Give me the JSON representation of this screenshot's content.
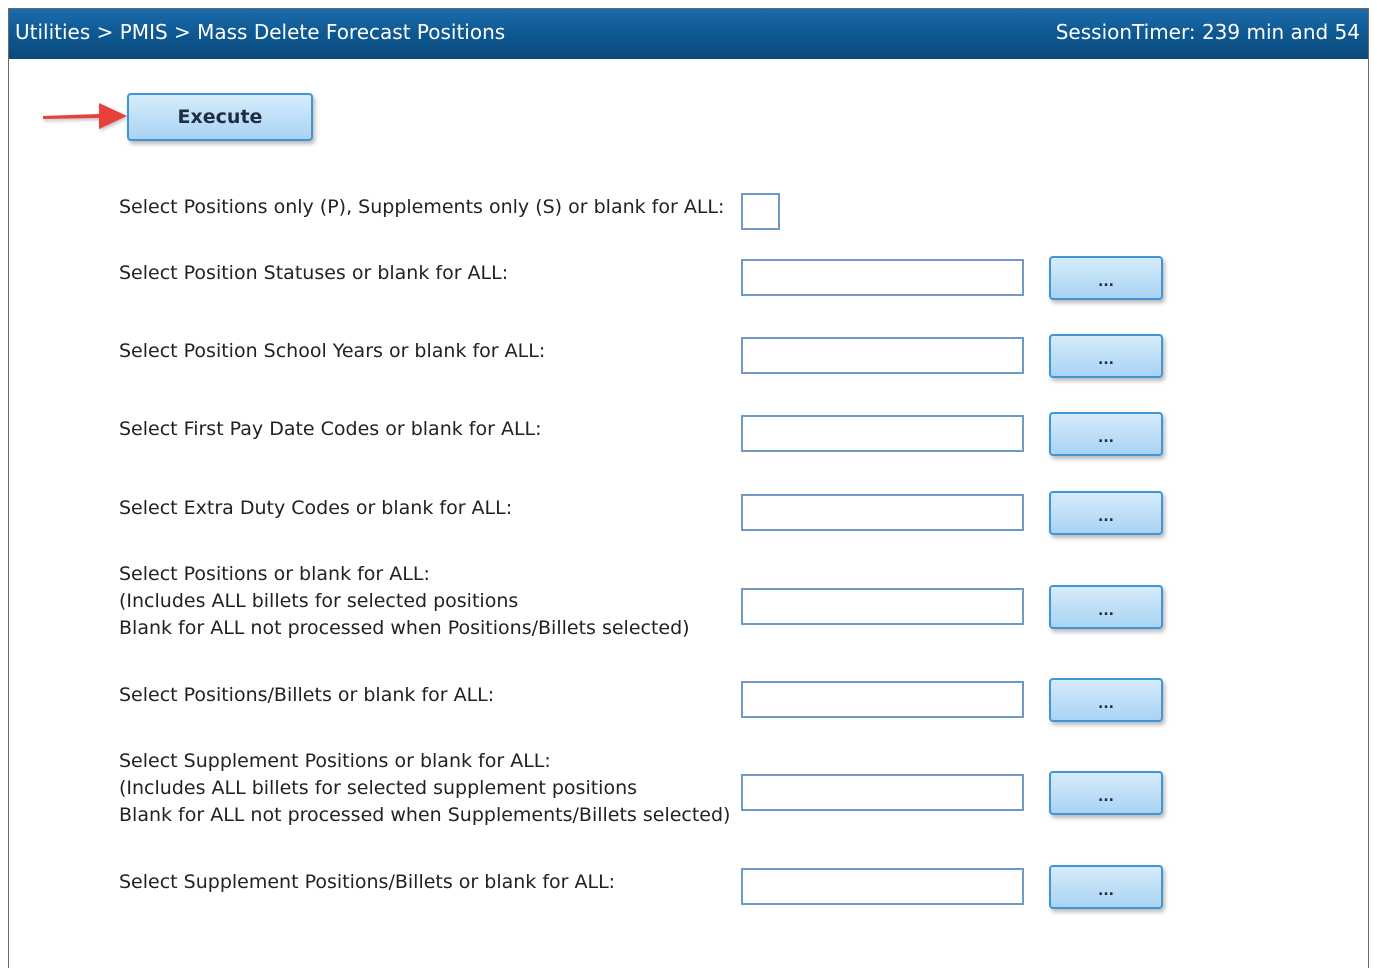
{
  "header": {
    "breadcrumb": "Utilities > PMIS > Mass Delete Forecast Positions",
    "session_timer": "SessionTimer: 239 min and 54"
  },
  "toolbar": {
    "execute_label": "Execute"
  },
  "rows": [
    {
      "label_lines": [
        "Select Positions only (P), Supplements only (S) or blank for ALL:"
      ],
      "value": "",
      "button_label": ""
    },
    {
      "label_lines": [
        "Select Position Statuses or blank for ALL:"
      ],
      "value": "",
      "button_label": "..."
    },
    {
      "label_lines": [
        "Select Position School Years or blank for ALL:"
      ],
      "value": "",
      "button_label": "..."
    },
    {
      "label_lines": [
        "Select First Pay Date Codes or blank for ALL:"
      ],
      "value": "",
      "button_label": "..."
    },
    {
      "label_lines": [
        "Select Extra Duty Codes or blank for ALL:"
      ],
      "value": "",
      "button_label": "..."
    },
    {
      "label_lines": [
        "Select Positions or blank for ALL:",
        "(Includes ALL billets for selected positions",
        "Blank for ALL not processed when Positions/Billets selected)"
      ],
      "value": "",
      "button_label": "..."
    },
    {
      "label_lines": [
        "Select Positions/Billets or blank for ALL:"
      ],
      "value": "",
      "button_label": "..."
    },
    {
      "label_lines": [
        "Select Supplement Positions or blank for ALL:",
        "(Includes ALL billets for selected supplement positions",
        "Blank for ALL not processed when Supplements/Billets selected)"
      ],
      "value": "",
      "button_label": "..."
    },
    {
      "label_lines": [
        "Select Supplement Positions/Billets or blank for ALL:"
      ],
      "value": "",
      "button_label": "..."
    }
  ],
  "colors": {
    "titlebar": "#0d568f",
    "button_fill": "#a9d3f3",
    "button_border": "#3f95d6",
    "arrow": "#e8413a"
  }
}
